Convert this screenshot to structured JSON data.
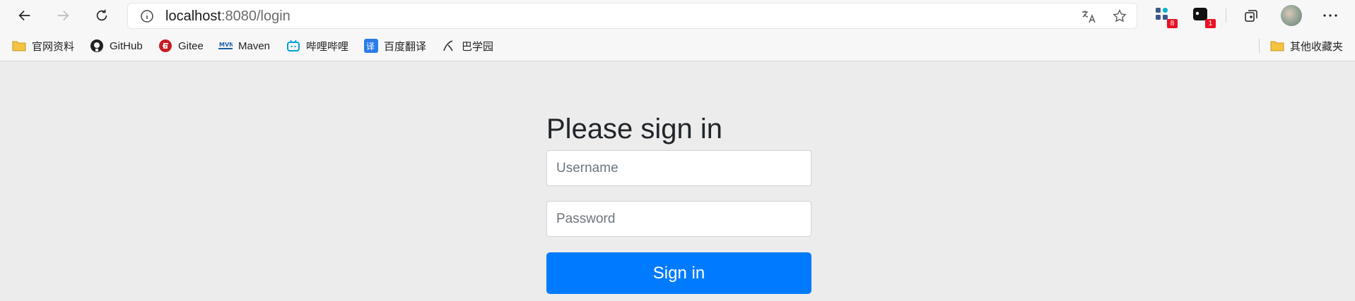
{
  "browser": {
    "address": {
      "host": "localhost",
      "rest": ":8080/login"
    },
    "extensions": [
      {
        "name": "extension-grid-icon",
        "badge": "8"
      },
      {
        "name": "extension-dark-icon",
        "badge": "1"
      }
    ]
  },
  "bookmarks": [
    {
      "icon": "folder-icon",
      "label": "官网资料"
    },
    {
      "icon": "github-icon",
      "label": "GitHub"
    },
    {
      "icon": "gitee-icon",
      "label": "Gitee"
    },
    {
      "icon": "maven-icon",
      "label": "Maven"
    },
    {
      "icon": "bilibili-icon",
      "label": "哔哩哔哩"
    },
    {
      "icon": "baidu-translate-icon",
      "label": "百度翻译"
    },
    {
      "icon": "baxueyuan-icon",
      "label": "巴学园"
    }
  ],
  "other_bookmarks": {
    "icon": "folder-icon",
    "label": "其他收藏夹"
  },
  "login": {
    "heading": "Please sign in",
    "username_placeholder": "Username",
    "password_placeholder": "Password",
    "submit_label": "Sign in"
  },
  "colors": {
    "primary": "#007bff",
    "background": "#ececec"
  }
}
